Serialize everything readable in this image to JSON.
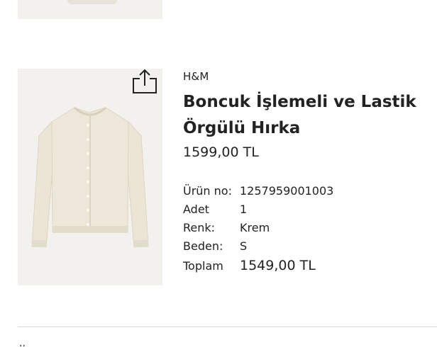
{
  "product": {
    "brand": "H&M",
    "title": "Boncuk İşlemeli ve Lastik Örgülü Hırka",
    "price": "1599,00 TL",
    "image_icon": "cardigan-image",
    "share_icon": "share-icon"
  },
  "details": [
    {
      "label": "Ürün no:",
      "value": "1257959001003"
    },
    {
      "label": "Adet",
      "value": "1"
    },
    {
      "label": "Renk:",
      "value": "Krem"
    },
    {
      "label": "Beden:",
      "value": "S"
    },
    {
      "label": "Toplam",
      "value": "1549,00 TL"
    }
  ],
  "bottom_glyph": "..",
  "colors": {
    "image_bg": "#f2f1ee",
    "garment": "#ebe5d6",
    "text": "#222222"
  }
}
